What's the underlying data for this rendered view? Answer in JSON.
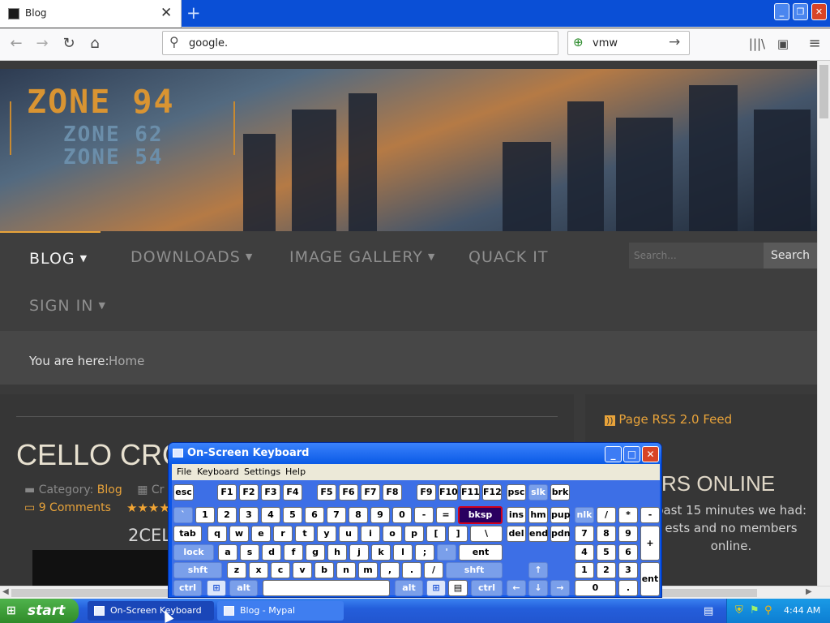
{
  "browser": {
    "tab_title": "Blog",
    "url": "google.",
    "search_text": "vmw"
  },
  "site": {
    "logo": [
      "ZONE 94",
      "ZONE 62",
      "ZONE 54"
    ],
    "menu": [
      {
        "label": "BLOG",
        "dropdown": true
      },
      {
        "label": "DOWNLOADS",
        "dropdown": true
      },
      {
        "label": "IMAGE GALLERY",
        "dropdown": true
      },
      {
        "label": "QUACK IT",
        "dropdown": false
      },
      {
        "label": "SIGN IN",
        "dropdown": true
      }
    ],
    "search_placeholder": "Search...",
    "search_button": "Search",
    "breadcrumb_label": "You are here:",
    "breadcrumb_home": "Home",
    "article": {
      "title": "CELLO CROSSO",
      "category_label": "Category:",
      "category": "Blog",
      "category_next": "Cr",
      "comments": "9 Comments",
      "stars": "★★★★",
      "subtitle": "2CELL"
    },
    "sidebar": {
      "rss": "Page RSS 2.0 Feed",
      "users_title": "RS ONLINE",
      "users_text": "past 15 minutes we had: ests and no members online."
    }
  },
  "osk": {
    "title": "On-Screen Keyboard",
    "menu": [
      "File",
      "Keyboard",
      "Settings",
      "Help"
    ],
    "rows": {
      "fn": [
        "esc",
        "F1",
        "F2",
        "F3",
        "F4",
        "F5",
        "F6",
        "F7",
        "F8",
        "F9",
        "F10",
        "F11",
        "F12",
        "psc",
        "slk",
        "brk"
      ],
      "num": [
        "`",
        "1",
        "2",
        "3",
        "4",
        "5",
        "6",
        "7",
        "8",
        "9",
        "0",
        "-",
        "=",
        "bksp",
        "ins",
        "hm",
        "pup",
        "nlk",
        "/",
        "*",
        "-"
      ],
      "q": [
        "tab",
        "q",
        "w",
        "e",
        "r",
        "t",
        "y",
        "u",
        "i",
        "o",
        "p",
        "[",
        "]",
        "\\",
        "del",
        "end",
        "pdn",
        "7",
        "8",
        "9",
        "+"
      ],
      "a": [
        "lock",
        "a",
        "s",
        "d",
        "f",
        "g",
        "h",
        "j",
        "k",
        "l",
        ";",
        "'",
        "ent",
        "4",
        "5",
        "6"
      ],
      "z": [
        "shft",
        "z",
        "x",
        "c",
        "v",
        "b",
        "n",
        "m",
        ",",
        ".",
        "/",
        "shft",
        "↑",
        "1",
        "2",
        "3",
        "ent"
      ],
      "b": [
        "ctrl",
        "alt",
        "alt",
        "ctrl",
        "←",
        "↓",
        "→",
        "0",
        "."
      ]
    }
  },
  "taskbar": {
    "start": "start",
    "tasks": [
      "On-Screen Keyboard",
      "Blog - Mypal"
    ],
    "time": "4:44 AM"
  }
}
